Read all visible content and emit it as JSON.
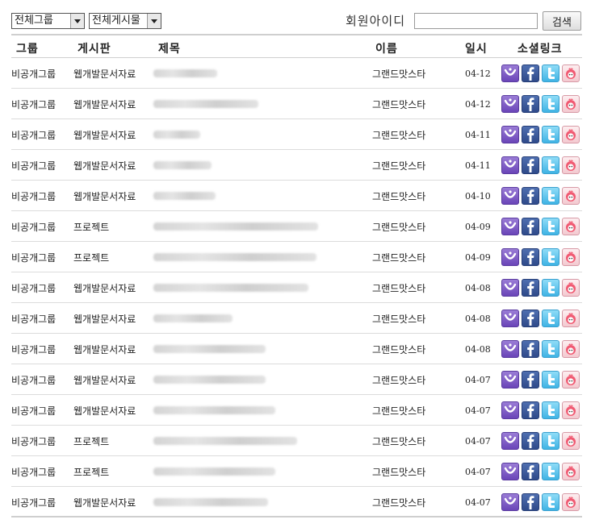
{
  "toolbar": {
    "group_select": "전체그룹",
    "board_select": "전체게시물",
    "search_label": "회원아이디",
    "search_value": "",
    "search_button": "검색"
  },
  "columns": {
    "group": "그룹",
    "board": "게시판",
    "title": "제목",
    "name": "이름",
    "date": "일시",
    "social": "소셜링크"
  },
  "rows": [
    {
      "group": "비공개그룹",
      "board": "웹개발문서자료",
      "title_blur": 0.33,
      "name": "그랜드맛스타",
      "date": "04-12"
    },
    {
      "group": "비공개그룹",
      "board": "웹개발문서자료",
      "title_blur": 0.54,
      "name": "그랜드맛스타",
      "date": "04-12"
    },
    {
      "group": "비공개그룹",
      "board": "웹개발문서자료",
      "title_blur": 0.24,
      "name": "그랜드맛스타",
      "date": "04-11"
    },
    {
      "group": "비공개그룹",
      "board": "웹개발문서자료",
      "title_blur": 0.3,
      "name": "그랜드맛스타",
      "date": "04-11"
    },
    {
      "group": "비공개그룹",
      "board": "웹개발문서자료",
      "title_blur": 0.32,
      "name": "그랜드맛스타",
      "date": "04-10"
    },
    {
      "group": "비공개그룹",
      "board": "프로젝트",
      "title_blur": 0.85,
      "name": "그랜드맛스타",
      "date": "04-09"
    },
    {
      "group": "비공개그룹",
      "board": "프로젝트",
      "title_blur": 0.84,
      "name": "그랜드맛스타",
      "date": "04-09"
    },
    {
      "group": "비공개그룹",
      "board": "웹개발문서자료",
      "title_blur": 0.8,
      "name": "그랜드맛스타",
      "date": "04-08"
    },
    {
      "group": "비공개그룹",
      "board": "웹개발문서자료",
      "title_blur": 0.41,
      "name": "그랜드맛스타",
      "date": "04-08"
    },
    {
      "group": "비공개그룹",
      "board": "웹개발문서자료",
      "title_blur": 0.58,
      "name": "그랜드맛스타",
      "date": "04-08"
    },
    {
      "group": "비공개그룹",
      "board": "웹개발문서자료",
      "title_blur": 0.58,
      "name": "그랜드맛스타",
      "date": "04-07"
    },
    {
      "group": "비공개그룹",
      "board": "웹개발문서자료",
      "title_blur": 0.63,
      "name": "그랜드맛스타",
      "date": "04-07"
    },
    {
      "group": "비공개그룹",
      "board": "프로젝트",
      "title_blur": 0.74,
      "name": "그랜드맛스타",
      "date": "04-07"
    },
    {
      "group": "비공개그룹",
      "board": "프로젝트",
      "title_blur": 0.63,
      "name": "그랜드맛스타",
      "date": "04-07"
    },
    {
      "group": "비공개그룹",
      "board": "웹개발문서자료",
      "title_blur": 0.59,
      "name": "그랜드맛스타",
      "date": "04-07"
    }
  ],
  "social_icons": [
    "me2day-icon",
    "facebook-icon",
    "twitter-icon",
    "yozm-icon"
  ],
  "colors": {
    "me2day": "#6a45b8",
    "facebook": "#3b5998",
    "twitter": "#3fb3e4",
    "yozm": "#e65a6e",
    "border": "#cfcfcf"
  }
}
